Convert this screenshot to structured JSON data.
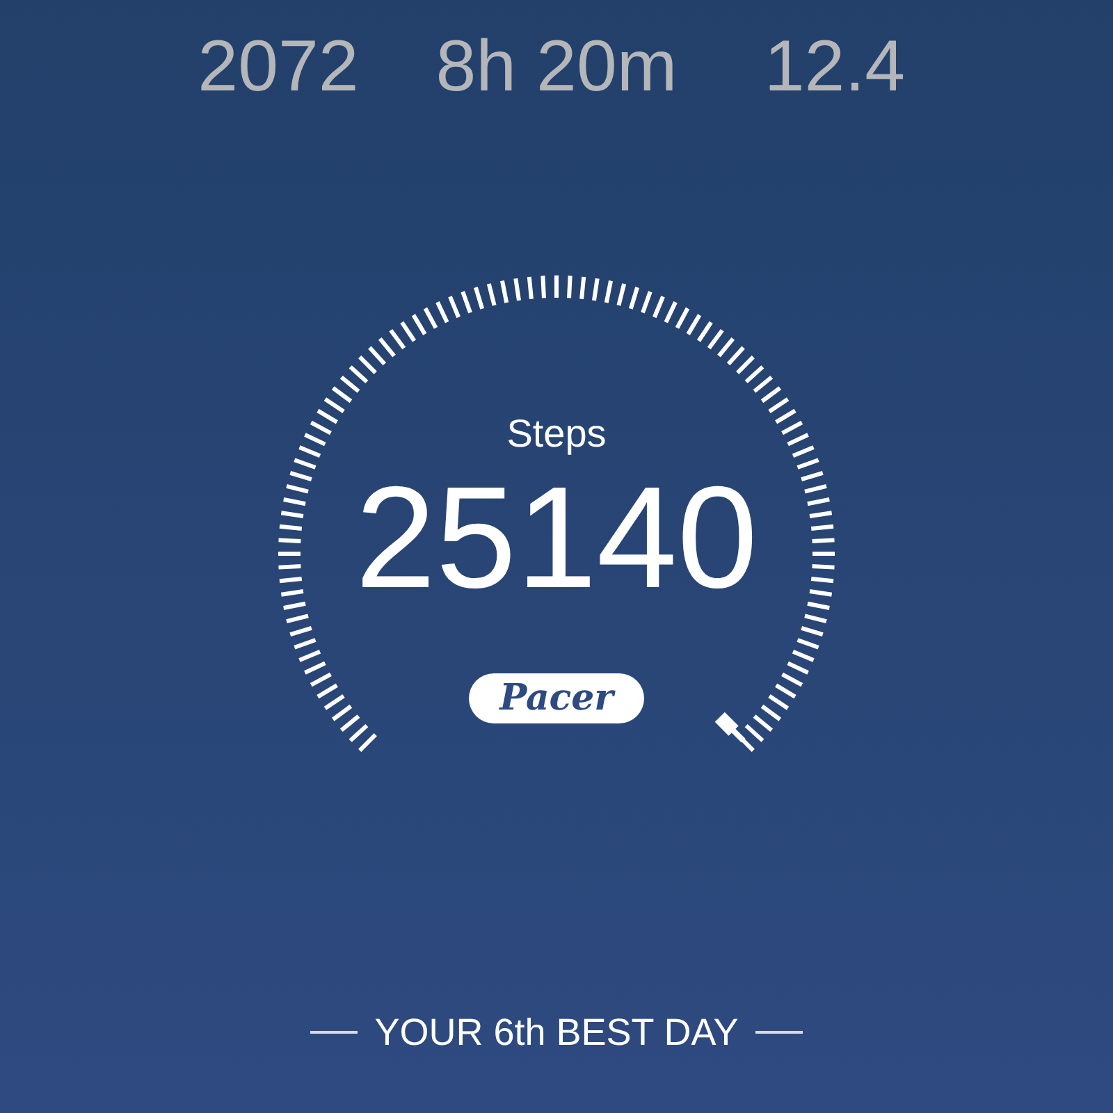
{
  "stats": [
    {
      "value": "2072"
    },
    {
      "value": "8h 20m"
    },
    {
      "value": "12.4"
    }
  ],
  "gauge": {
    "label": "Steps",
    "value": "25140"
  },
  "badge": "Pacer",
  "footer": "YOUR 6th BEST DAY"
}
